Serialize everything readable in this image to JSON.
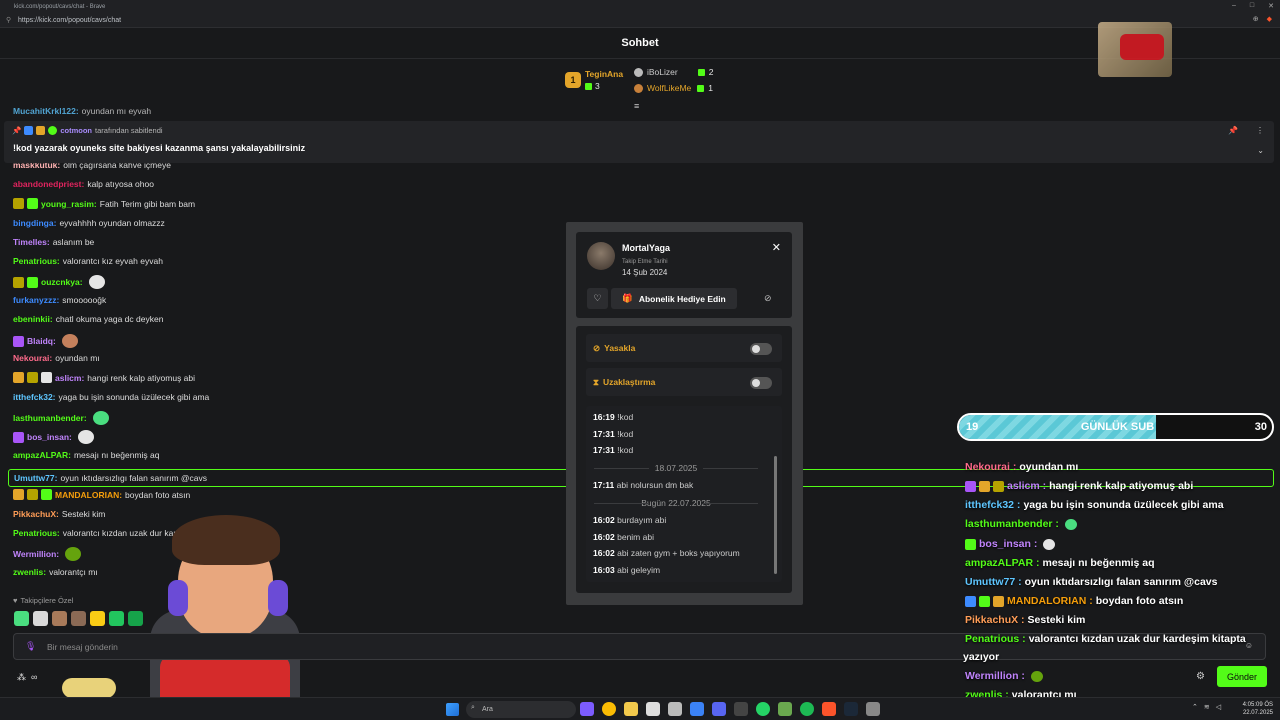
{
  "browser": {
    "title": "kick.com/popout/cavs/chat - Brave",
    "url": "https://kick.com/popout/cavs/chat"
  },
  "header": {
    "title": "Sohbet"
  },
  "gifters": {
    "first": {
      "rank": "1",
      "name": "TeginAna",
      "count": "3"
    },
    "second": {
      "name": "iBoLizer",
      "count": "2"
    },
    "third": {
      "name": "WolfLikeMe",
      "count": "1"
    }
  },
  "pinned": {
    "author": "cotmoon",
    "suffix": "tarafından sabitlendi",
    "text": "!kod yazarak oyuneks site bakiyesi kazanma şansı yakalayabilirsiniz"
  },
  "chat": {
    "messages": [
      {
        "user": "MucahitKrkl122",
        "text": "oyundan mı eyvah",
        "color": "#5ec6ff"
      },
      {
        "user": "maskkutuk",
        "text": "olm çağırsana kahve içmeye",
        "color": "#ffb3b3"
      },
      {
        "user": "abandonedpriest",
        "text": "kalp atıyosa ohoo",
        "color": "#e0245e"
      },
      {
        "user": "young_rasim",
        "text": "Fatih Terim gibi bam bam",
        "color": "#53fc18"
      },
      {
        "user": "bingdinga",
        "text": "eyvahhhh oyundan olmazzz",
        "color": "#3d8bff"
      },
      {
        "user": "Timelles",
        "text": "aslanım be",
        "color": "#c084fc"
      },
      {
        "user": "Penatrious",
        "text": "valorantcı kız eyvah eyvah",
        "color": "#53fc18"
      },
      {
        "user": "ouzcnkya",
        "text": "",
        "color": "#53fc18"
      },
      {
        "user": "furkanyzzz",
        "text": "smoooooğk",
        "color": "#3d8bff"
      },
      {
        "user": "ebeninkii",
        "text": "chatl okuma yaga dc deyken",
        "color": "#53fc18"
      },
      {
        "user": "Blaidq",
        "text": "",
        "color": "#c084fc"
      },
      {
        "user": "Nekourai",
        "text": "oyundan mı",
        "color": "#ff6b8b"
      },
      {
        "user": "aslicm",
        "text": "hangi renk kalp atiyomuş abi",
        "color": "#c084fc"
      },
      {
        "user": "itthefck32",
        "text": "yaga bu işin sonunda üzülecek gibi ama",
        "color": "#5ec6ff"
      },
      {
        "user": "lasthumanbender",
        "text": "",
        "color": "#53fc18"
      },
      {
        "user": "bos_insan",
        "text": "",
        "color": "#c084fc"
      },
      {
        "user": "ampazALPAR",
        "text": "mesajı nı beğenmiş aq",
        "color": "#53fc18"
      },
      {
        "user": "Umuttw77",
        "text": "oyun ıktıdarsızlıgı falan sanırım @cavs",
        "color": "#5ec6ff"
      },
      {
        "user": "MANDALORIAN",
        "text": "boydan foto atsın",
        "color": "#f59e0b"
      },
      {
        "user": "PikkachuX",
        "text": "Sesteki kim",
        "color": "#ff9d57"
      },
      {
        "user": "Penatrious",
        "text": "valorantcı kızdan uzak dur karde",
        "color": "#53fc18"
      },
      {
        "user": "Wermillion",
        "text": "",
        "color": "#c084fc"
      },
      {
        "user": "zwenlis",
        "text": "valorantçı mı",
        "color": "#53fc18"
      }
    ],
    "followers_only": "Takipçilere Özel",
    "input_placeholder": "Bir mesaj gönderin",
    "send_label": "Gönder"
  },
  "profile_popup": {
    "username": "MortalYaga",
    "follow_label": "Takip Etme Tarihi",
    "follow_date": "14 Şub 2024",
    "gift_label": "Abonelik Hediye Edin",
    "ban_label": "Yasakla",
    "timeout_label": "Uzaklaştırma",
    "history": {
      "early": [
        {
          "time": "16:19",
          "text": "!kod"
        },
        {
          "time": "17:31",
          "text": "!kod"
        },
        {
          "time": "17:31",
          "text": "!kod"
        }
      ],
      "date1": "18.07.2025",
      "mid": [
        {
          "time": "17:11",
          "text": "abi nolursun dm bak"
        }
      ],
      "date2": "Bugün 22.07.2025",
      "today": [
        {
          "time": "16:02",
          "text": "burdayım abi"
        },
        {
          "time": "16:02",
          "text": "benim abi"
        },
        {
          "time": "16:02",
          "text": "abi zaten gym + boks yapıyorum"
        },
        {
          "time": "16:03",
          "text": "abi geleyim"
        }
      ]
    }
  },
  "overlay": {
    "sub_goal": {
      "current": "19",
      "label": "GÜNLÜK SUB",
      "target": "30",
      "progress": 0.63
    },
    "messages": [
      {
        "user": "Nekourai",
        "text": "oyundan mı",
        "color": "#ff6b8b"
      },
      {
        "user": "aslicm",
        "text": "hangi renk kalp atiyomuş abi",
        "color": "#c084fc"
      },
      {
        "user": "itthefck32",
        "text": "yaga bu işin sonunda üzülecek gibi ama",
        "color": "#5ec6ff"
      },
      {
        "user": "lasthumanbender",
        "text": "",
        "color": "#53fc18"
      },
      {
        "user": "bos_insan",
        "text": "",
        "color": "#c084fc"
      },
      {
        "user": "ampazALPAR",
        "text": "mesajı nı beğenmiş aq",
        "color": "#53fc18"
      },
      {
        "user": "Umuttw77",
        "text": "oyun ıktıdarsızlıgı falan sanırım @cavs",
        "color": "#5ec6ff"
      },
      {
        "user": "MANDALORIAN",
        "text": "boydan foto atsın",
        "color": "#f59e0b"
      },
      {
        "user": "PikkachuX",
        "text": "Sesteki kim",
        "color": "#ff9d57"
      },
      {
        "user": "Penatrious",
        "text": "valorantcı kızdan uzak dur kardeşim kitapta",
        "color": "#53fc18"
      },
      {
        "user": "",
        "text": "yazıyor",
        "color": "#ffffff"
      },
      {
        "user": "Wermillion",
        "text": "",
        "color": "#c084fc"
      },
      {
        "user": "zwenlis",
        "text": "valorantçı mı",
        "color": "#53fc18"
      }
    ]
  },
  "taskbar": {
    "search_placeholder": "Ara",
    "time": "4:05:09 ÖS",
    "date": "22.07.2025"
  },
  "colors": {
    "accent": "#53fc18",
    "gold": "#e3a52a",
    "background": "#18191b"
  }
}
